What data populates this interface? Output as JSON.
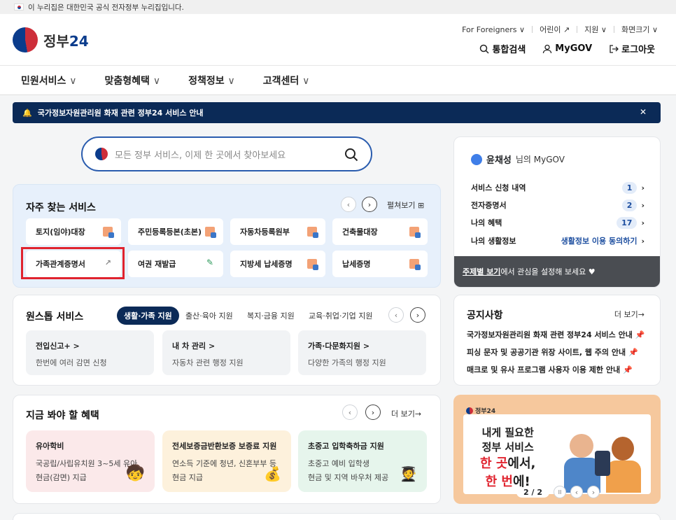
{
  "gov_bar": {
    "text": "이 누리집은 대한민국 공식 전자정부 누리집입니다."
  },
  "logo": {
    "name": "정부",
    "num": "24"
  },
  "util_links": [
    {
      "label": "For Foreigners ∨"
    },
    {
      "label": "어린이 ↗"
    },
    {
      "label": "지원 ∨"
    },
    {
      "label": "화면크기 ∨"
    }
  ],
  "top_actions": {
    "search": "통합검색",
    "mygov": "MyGOV",
    "logout": "로그아웃"
  },
  "nav": [
    {
      "label": "민원서비스"
    },
    {
      "label": "맞춤형혜택"
    },
    {
      "label": "정책정보"
    },
    {
      "label": "고객센터"
    }
  ],
  "notice_bar": {
    "text": "국가정보자원관리원 화재 관련 정부24 서비스 안내",
    "close": "✕"
  },
  "search": {
    "placeholder": "모든 정부 서비스, 이제 한 곳에서 찾아보세요"
  },
  "frequent": {
    "title": "자주 찾는 서비스",
    "expand": "펼쳐보기",
    "items": [
      {
        "label": "토지(임야)대장"
      },
      {
        "label": "주민등록등본(초본)"
      },
      {
        "label": "자동차등록원부"
      },
      {
        "label": "건축물대장"
      },
      {
        "label": "가족관계증명서"
      },
      {
        "label": "여권 재발급"
      },
      {
        "label": "지방세 납세증명"
      },
      {
        "label": "납세증명"
      }
    ]
  },
  "onestop": {
    "title": "원스톱 서비스",
    "tabs": [
      {
        "label": "생활·가족 지원"
      },
      {
        "label": "출산·육아 지원"
      },
      {
        "label": "복지·금융 지원"
      },
      {
        "label": "교육·취업·기업 지원"
      }
    ],
    "items": [
      {
        "title": "전입신고+ >",
        "desc": "한번에 여러 감면 신청"
      },
      {
        "title": "내 차 관리 >",
        "desc": "자동차 관련 행정 지원"
      },
      {
        "title": "가족·다문화지원 >",
        "desc": "다양한 가족의 행정 지원"
      }
    ]
  },
  "benefits": {
    "title": "지금 봐야 할 혜택",
    "more": "더 보기→",
    "items": [
      {
        "title": "유아학비",
        "line1": "국공립/사립유치원 3~5세 유아",
        "line2": "현금(감면) 지급",
        "bg": "#fbe9ea"
      },
      {
        "title": "전세보증금반환보증 보증료 지원",
        "line1": "연소득 기준에 청년, 신혼부부 등",
        "line2": "현금 지급",
        "bg": "#fdf1dc"
      },
      {
        "title": "초중고 입학축하금 지원",
        "line1": "초중고 예비 입학생",
        "line2": "현금 및 지역 바우처 제공",
        "bg": "#e6f5ec"
      }
    ]
  },
  "mygov": {
    "name": "윤채성",
    "suffix": "님의 MyGOV",
    "rows": [
      {
        "label": "서비스 신청 내역",
        "count": "1"
      },
      {
        "label": "전자증명서",
        "count": "2"
      },
      {
        "label": "나의 혜택",
        "count": "17"
      }
    ],
    "life_label": "나의 생활정보",
    "life_link": "생활정보 이용 동의하기",
    "foot_link": "주제별 보기",
    "foot_text": "에서 관심을 설정해 보세요 ♥"
  },
  "notices": {
    "title": "공지사항",
    "more": "더 보기→",
    "items": [
      {
        "label": "국가정보자원관리원 화재 관련 정부24 서비스 안내"
      },
      {
        "label": "피싱 문자 및 공공기관 위장 사이트, 웹 주의 안내"
      },
      {
        "label": "매크로 및 유사 프로그램 사용자 이용 제한 안내"
      }
    ]
  },
  "banner": {
    "logo": "정부24",
    "line1": "내게 필요한",
    "line2": "정부 서비스",
    "line3a": "한 곳",
    "line3b": "에서,",
    "line4a": "한 번",
    "line4b": "에!",
    "page": "2 / 2"
  },
  "colors": {
    "brand": "#0b2a57",
    "accent": "#e0232e",
    "link": "#1e4fa0"
  }
}
